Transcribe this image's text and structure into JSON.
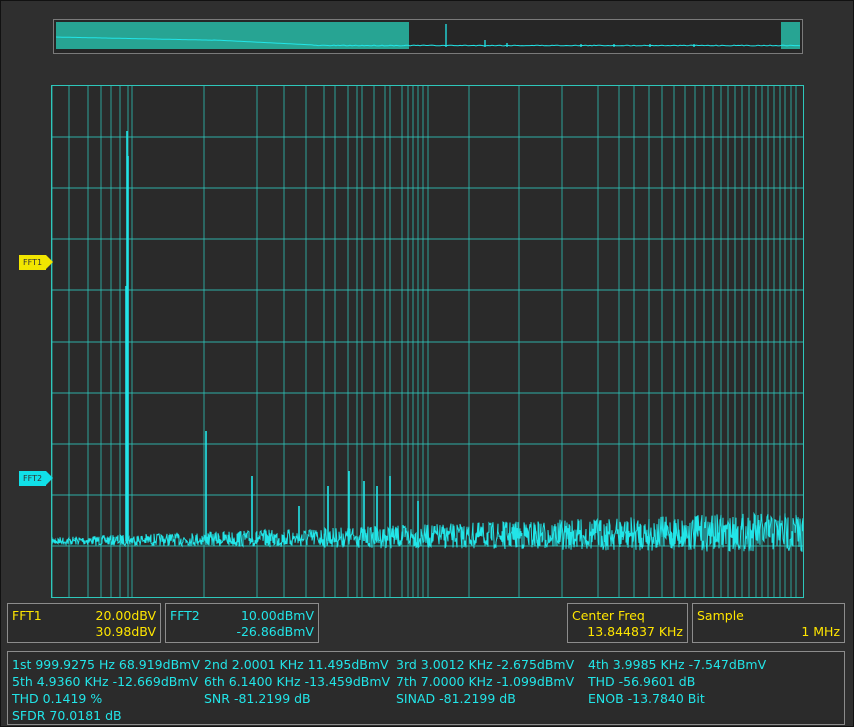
{
  "colors": {
    "trace": "#22e5e8",
    "grid": "#2ec7bb",
    "overview_fill": "#27a493",
    "fft1": "#f2e600",
    "fft2": "#11e0e8",
    "text_yellow": "#ffe600"
  },
  "markers": {
    "fft1": "FFT1",
    "fft2": "FFT2"
  },
  "fft1_box": {
    "label": "FFT1",
    "scale": "20.00dBV",
    "offset": "30.98dBV"
  },
  "fft2_box": {
    "label": "FFT2",
    "scale": "10.00dBmV",
    "offset": "-26.86dBmV"
  },
  "center_freq": {
    "label": "Center Freq",
    "value": "13.844837 KHz"
  },
  "sample": {
    "label": "Sample",
    "value": "1 MHz"
  },
  "stats": {
    "h1": "1st 999.9275 Hz  68.919dBmV",
    "h2": "2nd 2.0001 KHz  11.495dBmV",
    "h3": "3rd 3.0012 KHz  -2.675dBmV",
    "h4": "4th 3.9985 KHz  -7.547dBmV",
    "h5": "5th 4.9360 KHz  -12.669dBmV",
    "h6": "6th 6.1400 KHz  -13.459dBmV",
    "h7": "7th 7.0000 KHz  -1.099dBmV",
    "thd_db": "THD  -56.9601 dB",
    "thd_pct": "THD  0.1419 %",
    "snr": "SNR  -81.2199 dB",
    "sinad": "SINAD  -81.2199 dB",
    "enob": "ENOB  -13.7840 Bit",
    "sfdr": "SFDR  70.0181 dB"
  }
}
